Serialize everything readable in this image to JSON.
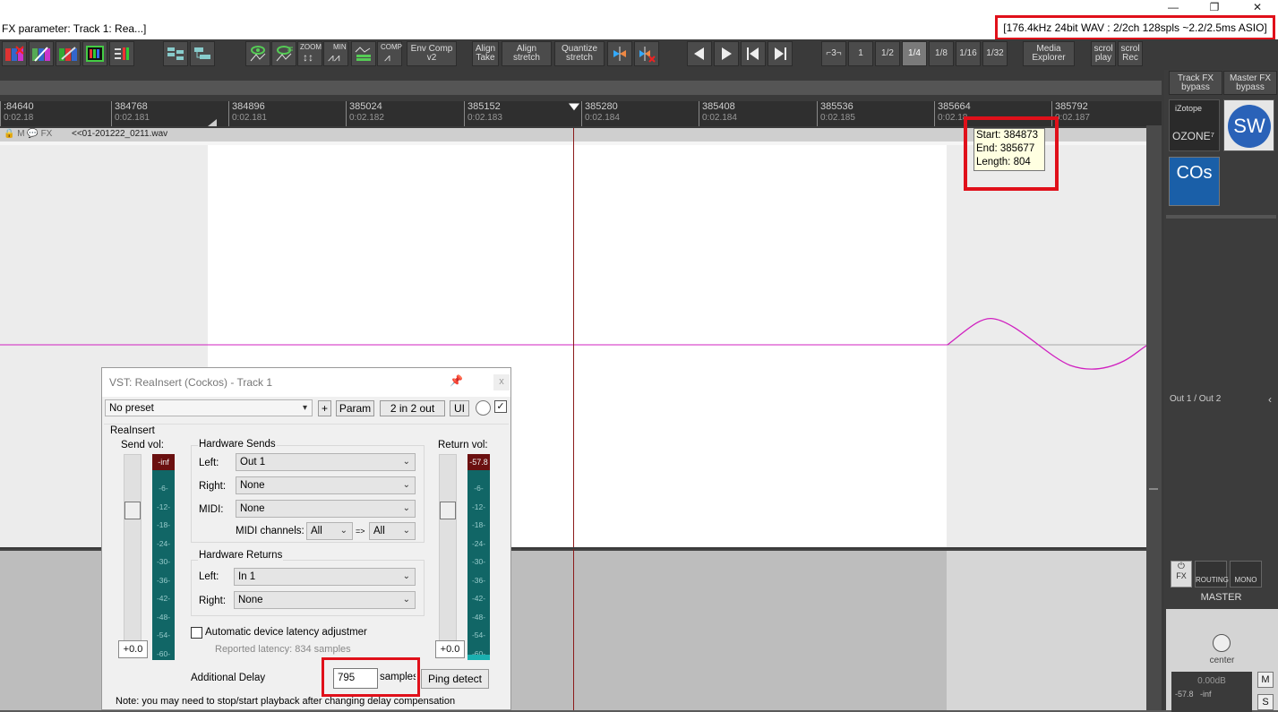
{
  "title_bar": {
    "title": "FX parameter: Track 1: Rea...]",
    "audio_info": "[176.4kHz 24bit WAV : 2/2ch 128spls ~2.2/2.5ms ASIO]",
    "minimize": "—",
    "restore": "❐",
    "close": "✕"
  },
  "toolbar": {
    "zoom_label": "ZOOM",
    "min_label": "MIN",
    "comp_label": "COMP",
    "env_comp": "Env Comp v2",
    "align_take": "Align Take",
    "align_stretch": "Align stretch",
    "quantize_stretch": "Quantize stretch",
    "grid_triplet": "⌐3¬",
    "grid_values": [
      "1",
      "1/2",
      "1/4",
      "1/8",
      "1/16",
      "1/32"
    ],
    "grid_selected": "1/4",
    "media_explorer": "Media Explorer",
    "scroll_play": "scrol play",
    "scroll_rec": "scrol Rec",
    "track_fx_bypass": "Track FX bypass",
    "master_fx_bypass": "Master FX bypass"
  },
  "ruler": {
    "ticks": [
      {
        "pos": ":84640",
        "time": "0:02.18"
      },
      {
        "pos": "384768",
        "time": "0:02.181"
      },
      {
        "pos": "384896",
        "time": "0:02.181"
      },
      {
        "pos": "385024",
        "time": "0:02.182"
      },
      {
        "pos": "385152",
        "time": "0:02.183"
      },
      {
        "pos": "385280",
        "time": "0:02.184"
      },
      {
        "pos": "385408",
        "time": "0:02.184"
      },
      {
        "pos": "385536",
        "time": "0:02.185"
      },
      {
        "pos": "385664",
        "time": "0:02.18"
      },
      {
        "pos": "385792",
        "time": "0:02.187"
      }
    ]
  },
  "track": {
    "item_name": "<<01-201222_0211.wav",
    "header_icons": "🔒 M 💬 FX"
  },
  "tooltip": {
    "start": "Start: 384873",
    "end": "End: 385677",
    "length": "Length: 804"
  },
  "master": {
    "izotope": "iZotope",
    "ozone": "OZONE⁷",
    "sw": "SW",
    "cos": "COs",
    "output": "Out 1 / Out 2",
    "fx": "FX",
    "routing": "ROUTING",
    "mono": "MONO",
    "label": "MASTER",
    "pan": "center",
    "db": "0.00dB",
    "peak_l": "-57.8",
    "peak_r": "-inf",
    "m": "M",
    "s": "S"
  },
  "fx_window": {
    "title": "VST: ReaInsert (Cockos) - Track 1",
    "pin": "📌",
    "close": "x",
    "preset": "No preset",
    "plus": "+",
    "param": "Param",
    "io": "2 in 2 out",
    "ui": "UI",
    "plugin_name": "ReaInsert",
    "send_vol_label": "Send vol:",
    "return_vol_label": "Return vol:",
    "send_peak": "-inf",
    "return_peak": "-57.8",
    "meter_scale": [
      "-6-",
      "-12-",
      "-18-",
      "-24-",
      "-30-",
      "-36-",
      "-42-",
      "-48-",
      "-54-",
      "-60-"
    ],
    "send_vol_value": "+0.0",
    "return_vol_value": "+0.0",
    "hardware_sends": "Hardware Sends",
    "left_label": "Left:",
    "right_label": "Right:",
    "midi_label": "MIDI:",
    "send_left": "Out 1",
    "send_right": "None",
    "send_midi": "None",
    "midi_channels_label": "MIDI channels:",
    "midi_ch_from": "All",
    "midi_arrow": "=>",
    "midi_ch_to": "All",
    "hardware_returns": "Hardware Returns",
    "return_left": "In 1",
    "return_right": "None",
    "auto_latency": "Automatic device latency adjustmer",
    "reported_latency": "Reported latency: 834 samples",
    "additional_delay_label": "Additional Delay",
    "additional_delay_value": "795",
    "samples_label": "samples",
    "ping_detect": "Ping detect",
    "note": "Note: you may need to stop/start playback after changing delay compensation"
  }
}
